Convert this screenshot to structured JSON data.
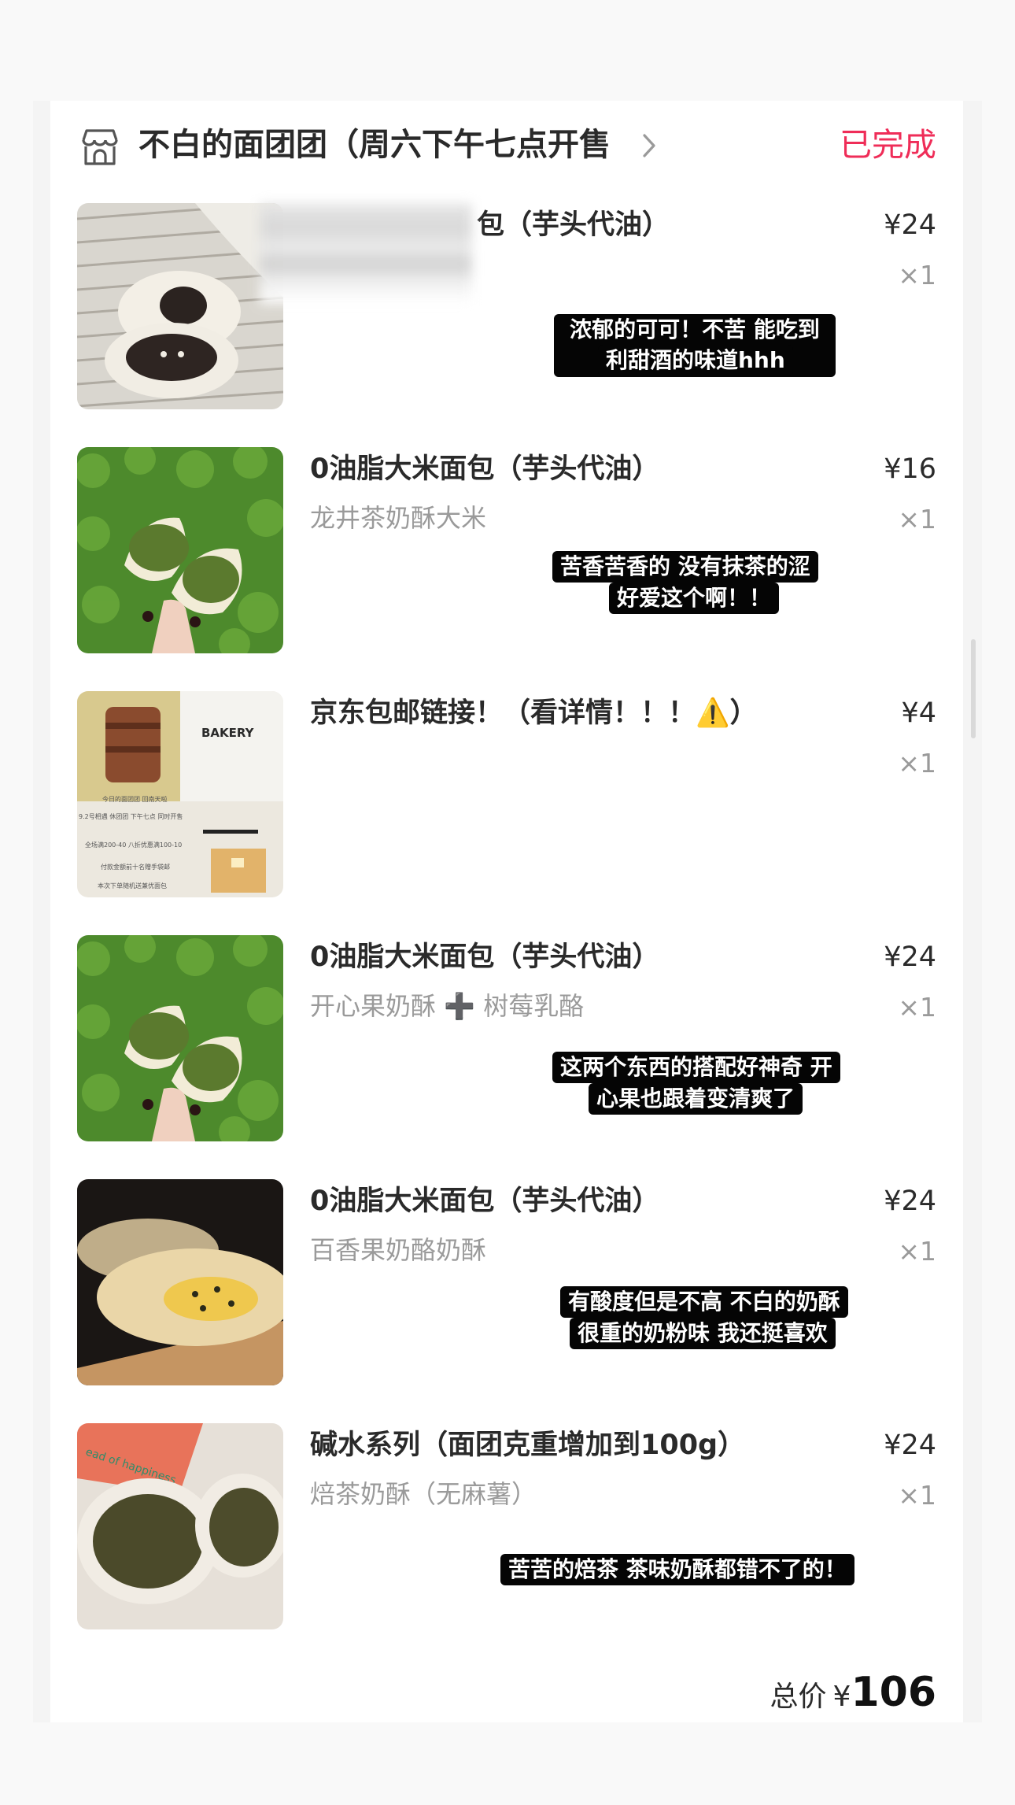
{
  "store": {
    "name": "不白的面团团（周六下午七点开售",
    "status": "已完成",
    "status_color": "#ef2d58"
  },
  "items": [
    {
      "title": "包（芋头代油）",
      "spec": "",
      "price": "¥24",
      "qty": "×1",
      "note": [
        "浓郁的可可！不苦 能吃到百",
        "利甜酒的味道hhh"
      ]
    },
    {
      "title": "0油脂大米面包（芋头代油）",
      "spec": "龙井茶奶酥大米",
      "price": "¥16",
      "qty": "×1",
      "note": [
        "苦香苦香的 没有抹茶的涩",
        "好爱这个啊！！"
      ]
    },
    {
      "title": "京东包邮链接！（看详情！！！⚠️）",
      "spec": "",
      "price": "¥4",
      "qty": "×1",
      "thumb_text": [
        "BAKERY",
        "今日的面团团 回南天啦",
        "9.2号相遇 休团团 下午七点 同时开售",
        "全场满200-40 八折优惠满100-10",
        "付款金额前十名赠手袋邮",
        "本次下单随机送兼优面包"
      ]
    },
    {
      "title": "0油脂大米面包（芋头代油）",
      "spec": "开心果奶酥 ➕ 树莓乳酪",
      "price": "¥24",
      "qty": "×1",
      "note": [
        "这两个东西的搭配好神奇 开",
        "心果也跟着变清爽了"
      ]
    },
    {
      "title": "0油脂大米面包（芋头代油）",
      "spec": "百香果奶酪奶酥",
      "price": "¥24",
      "qty": "×1",
      "note": [
        "有酸度但是不高 不白的奶酥",
        "很重的奶粉味 我还挺喜欢"
      ]
    },
    {
      "title": "碱水系列（面团克重增加到100g）",
      "spec": "焙茶奶酥（无麻薯）",
      "price": "¥24",
      "qty": "×1",
      "note": [
        "苦苦的焙茶 茶味奶酥都错不了的！"
      ],
      "thumb_text": [
        "ead of happiness"
      ]
    }
  ],
  "total": {
    "label": "总价",
    "currency": "¥",
    "amount": "106"
  }
}
